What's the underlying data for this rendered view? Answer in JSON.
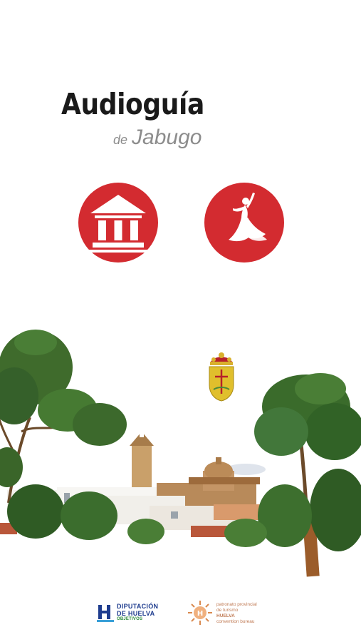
{
  "header": {
    "title": "Audioguía",
    "subtitle_prefix": "de",
    "subtitle_place": "Jabugo"
  },
  "buttons": [
    {
      "icon": "monument-icon"
    },
    {
      "icon": "flamenco-dancer-icon"
    }
  ],
  "crest": {
    "icon": "coat-of-arms-icon"
  },
  "footer": {
    "logo1_line1": "DIPUTACIÓN",
    "logo1_line2": "DE HUELVA",
    "logo1_line3": "OBJETIVOS",
    "logo2_line1": "patronato provincial",
    "logo2_line2": "de turismo",
    "logo2_line3": "HUELVA",
    "logo2_line4": "convention bureau"
  },
  "colors": {
    "accent_red": "#d32b30",
    "title": "#1a1a1a",
    "subtitle": "#8c8c8c",
    "brand_blue": "#1f3d8f",
    "brand_orange": "#c07b55"
  }
}
